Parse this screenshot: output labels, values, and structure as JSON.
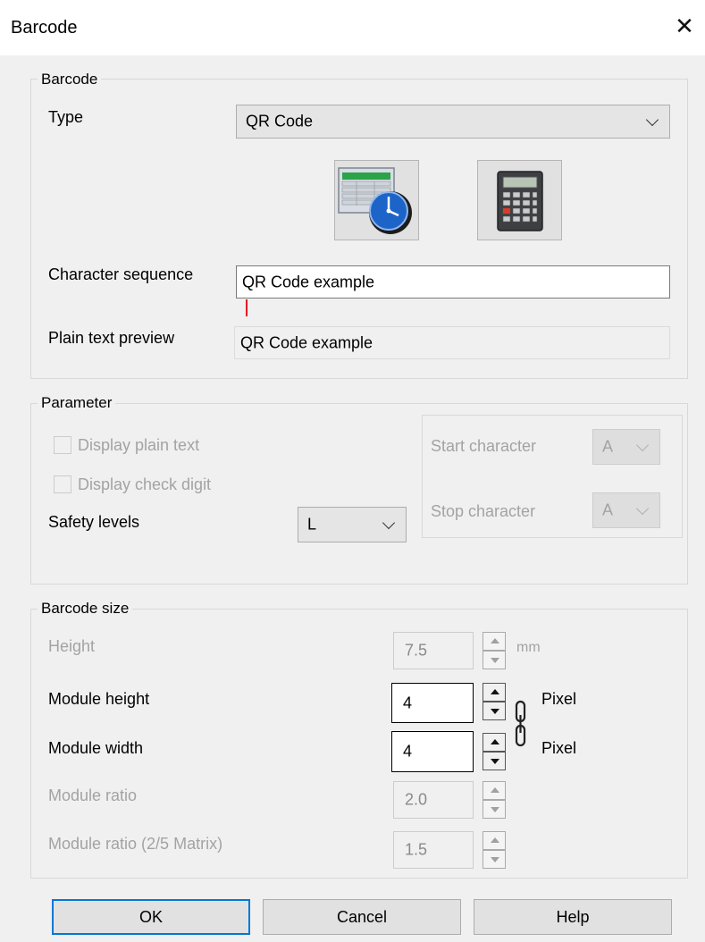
{
  "window": {
    "title": "Barcode",
    "close_glyph": "✕"
  },
  "barcode_group": {
    "label": "Barcode",
    "type_label": "Type",
    "type_value": "QR Code",
    "icon_database": "database-clock-icon",
    "icon_calculator": "calculator-icon",
    "char_seq_label": "Character sequence",
    "char_seq_value": "QR Code example",
    "preview_label": "Plain text preview",
    "preview_value": "QR Code example"
  },
  "parameter_group": {
    "label": "Parameter",
    "display_plain_text": "Display plain text",
    "display_check_digit": "Display check digit",
    "safety_levels_label": "Safety levels",
    "safety_levels_value": "L",
    "start_char_label": "Start character",
    "start_char_value": "A",
    "stop_char_label": "Stop character",
    "stop_char_value": "A"
  },
  "size_group": {
    "label": "Barcode size",
    "height_label": "Height",
    "height_value": "7.5",
    "height_unit": "mm",
    "module_height_label": "Module height",
    "module_height_value": "4",
    "module_height_unit": "Pixel",
    "module_width_label": "Module width",
    "module_width_value": "4",
    "module_width_unit": "Pixel",
    "module_ratio_label": "Module ratio",
    "module_ratio_value": "2.0",
    "module_ratio_25_label": "Module ratio (2/5 Matrix)",
    "module_ratio_25_value": "1.5"
  },
  "buttons": {
    "ok": "OK",
    "cancel": "Cancel",
    "help": "Help"
  },
  "colors": {
    "focus_border": "#0078d7",
    "disabled_text": "#a3a3a3",
    "caret": "#e81123"
  }
}
